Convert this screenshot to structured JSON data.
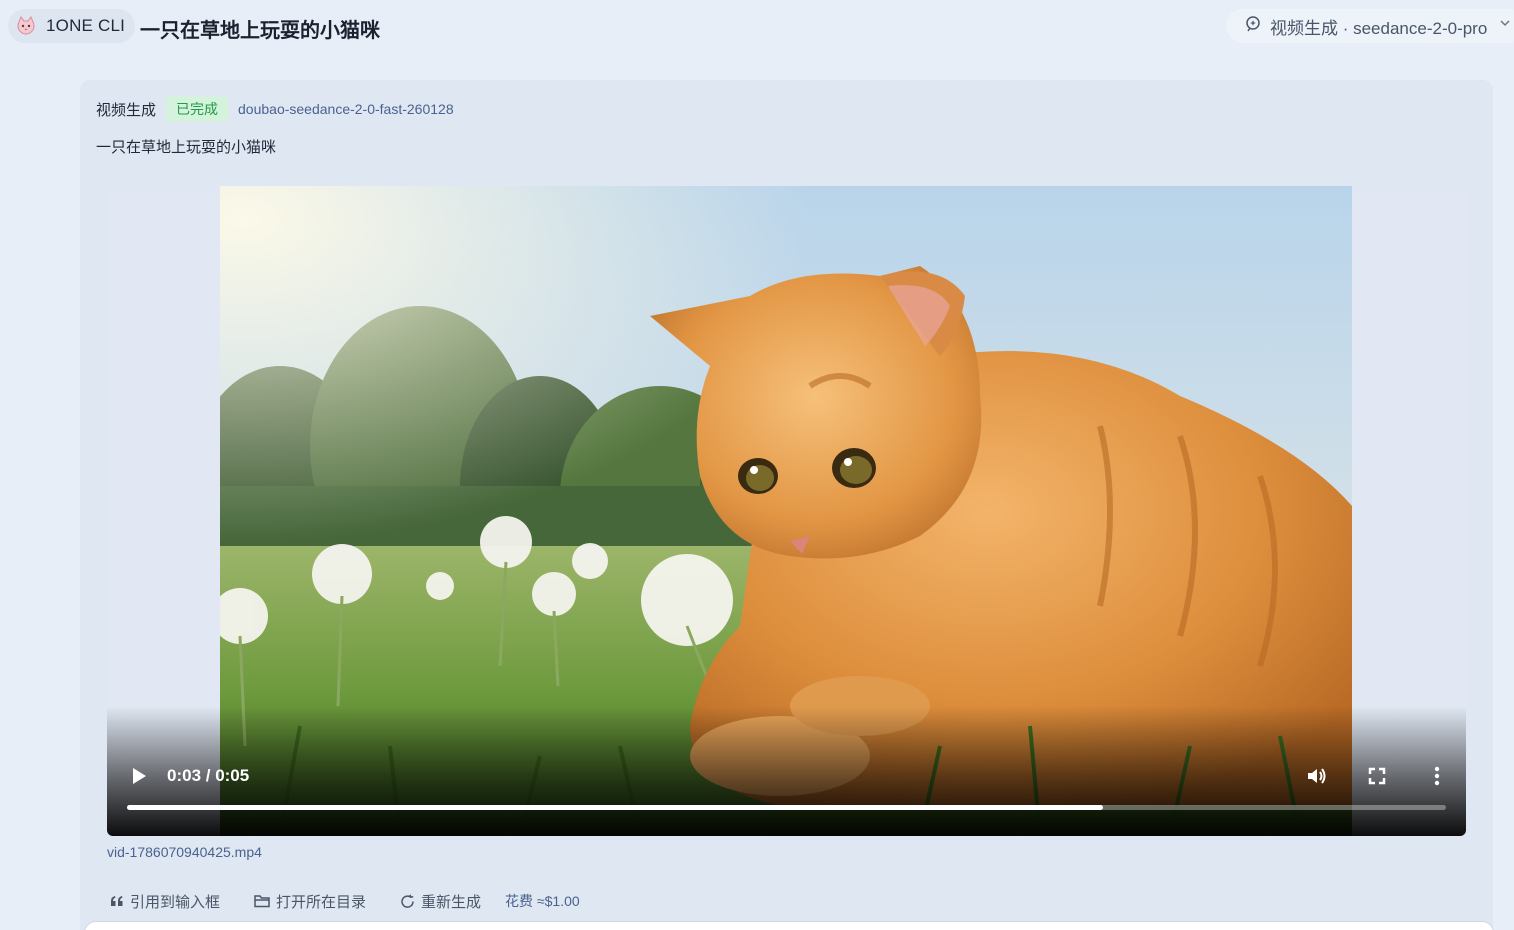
{
  "header": {
    "app_name": "1ONE CLI",
    "page_title": "一只在草地上玩耍的小猫咪",
    "model_selector": {
      "label": "视频生成 · seedance-2-0-pro",
      "icon": "sparkle-icon",
      "chevron": "chevron-down-icon"
    }
  },
  "message": {
    "kind": "视频生成",
    "status": "已完成",
    "model_id": "doubao-seedance-2-0-fast-260128",
    "prompt": "一只在草地上玩耍的小猫咪",
    "video": {
      "time_display": "0:03 / 0:05",
      "progress_fraction": 0.74,
      "controls": [
        "play-icon",
        "volume-icon",
        "fullscreen-icon",
        "more-vertical-icon"
      ]
    },
    "file_name": "vid-1786070940425.mp4",
    "actions": [
      {
        "label": "引用到输入框",
        "icon": "quote-icon"
      },
      {
        "label": "打开所在目录",
        "icon": "folder-icon"
      },
      {
        "label": "重新生成",
        "icon": "refresh-icon"
      }
    ],
    "cost": "花费 ≈$1.00"
  },
  "colors": {
    "background": "#e8eef8",
    "card": "#dfe7f2",
    "status_bg": "#d5f2dc",
    "status_text": "#1f9d45",
    "link": "#4a6290"
  }
}
